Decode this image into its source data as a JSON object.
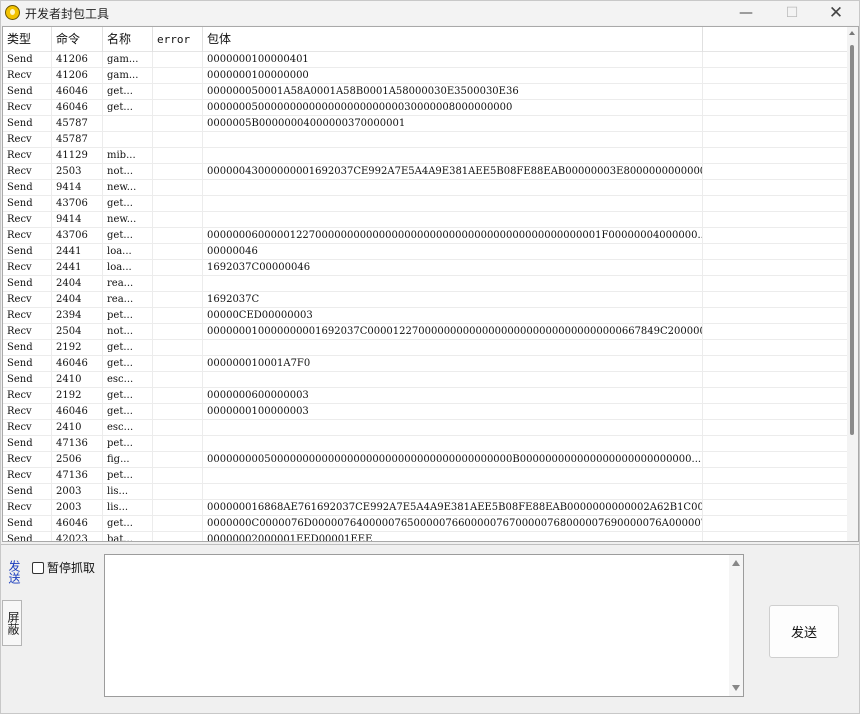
{
  "window": {
    "title": "开发者封包工具"
  },
  "titlebar": {
    "minimize_glyph": "—",
    "maximize_glyph": "☐",
    "close_glyph": "✕"
  },
  "table": {
    "columns": [
      "类型",
      "命令",
      "名称",
      "error",
      "包体",
      ""
    ],
    "rows": [
      [
        "Send",
        "41206",
        "gam...",
        "",
        "0000000100000401",
        ""
      ],
      [
        "Recv",
        "41206",
        "gam...",
        "",
        "0000000100000000",
        ""
      ],
      [
        "Send",
        "46046",
        "get...",
        "",
        "000000050001A58A0001A58B0001A58000030E3500030E36",
        ""
      ],
      [
        "Recv",
        "46046",
        "get...",
        "",
        "000000050000000000000000000000030000008000000000",
        ""
      ],
      [
        "Send",
        "45787",
        "",
        "",
        "0000005B00000004000000370000001",
        ""
      ],
      [
        "Recv",
        "45787",
        "",
        "",
        "",
        ""
      ],
      [
        "Recv",
        "41129",
        "mib...",
        "",
        "",
        ""
      ],
      [
        "Recv",
        "2503",
        "not...",
        "",
        "00000043000000001692037CE992A7E5A4A9E381AEE5B08FE88EAB00000003E8000000000000...",
        ""
      ],
      [
        "Send",
        "9414",
        "new...",
        "",
        "",
        ""
      ],
      [
        "Send",
        "43706",
        "get...",
        "",
        "",
        ""
      ],
      [
        "Recv",
        "9414",
        "new...",
        "",
        "",
        ""
      ],
      [
        "Recv",
        "43706",
        "get...",
        "",
        "00000006000001227000000000000000000000000000000000000000000001F00000004000000...",
        ""
      ],
      [
        "Send",
        "2441",
        "loa...",
        "",
        "00000046",
        ""
      ],
      [
        "Recv",
        "2441",
        "loa...",
        "",
        "1692037C00000046",
        ""
      ],
      [
        "Send",
        "2404",
        "rea...",
        "",
        "",
        ""
      ],
      [
        "Recv",
        "2404",
        "rea...",
        "",
        "1692037C",
        ""
      ],
      [
        "Recv",
        "2394",
        "pet...",
        "",
        "00000CED00000003",
        ""
      ],
      [
        "Recv",
        "2504",
        "not...",
        "",
        "000000010000000001692037C0000122700000000000000000000000000000000667849C2000003...",
        ""
      ],
      [
        "Send",
        "2192",
        "get...",
        "",
        "",
        ""
      ],
      [
        "Send",
        "46046",
        "get...",
        "",
        "000000010001A7F0",
        ""
      ],
      [
        "Send",
        "2410",
        "esc...",
        "",
        "",
        ""
      ],
      [
        "Recv",
        "2192",
        "get...",
        "",
        "0000000600000003",
        ""
      ],
      [
        "Recv",
        "46046",
        "get...",
        "",
        "0000000100000003",
        ""
      ],
      [
        "Recv",
        "2410",
        "esc...",
        "",
        "",
        ""
      ],
      [
        "Send",
        "47136",
        "pet...",
        "",
        "",
        ""
      ],
      [
        "Recv",
        "2506",
        "fig...",
        "",
        "000000000500000000000000000000000000000000000000B000000000000000000000000000...",
        ""
      ],
      [
        "Recv",
        "47136",
        "pet...",
        "",
        "",
        ""
      ],
      [
        "Send",
        "2003",
        "lis...",
        "",
        "",
        ""
      ],
      [
        "Recv",
        "2003",
        "lis...",
        "",
        "000000016868AE761692037CE992A7E5A4A9E381AEE5B08FE88EAB0000000000002A62B1C00030D...",
        ""
      ],
      [
        "Send",
        "46046",
        "get...",
        "",
        "0000000C0000076D0000076400000765000007660000076700000768000007690000076A000007...",
        ""
      ],
      [
        "Send",
        "42023",
        "bat...",
        "",
        "00000002000001EED00001EEE",
        ""
      ]
    ]
  },
  "bottom": {
    "tab_send": "发送",
    "tab_block": "屏蔽",
    "pause_capture_label": "暂停抓取",
    "pause_capture_checked": false,
    "packet_input_value": "",
    "send_button_label": "发送"
  }
}
